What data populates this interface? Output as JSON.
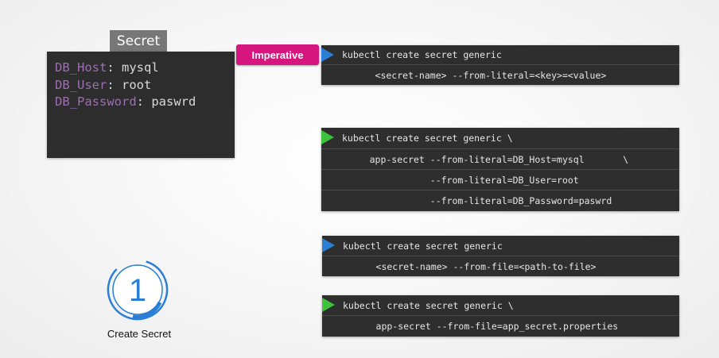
{
  "secret": {
    "tab_label": "Secret",
    "pairs": [
      {
        "key": "DB_Host",
        "value": "mysql"
      },
      {
        "key": "DB_User",
        "value": "root"
      },
      {
        "key": "DB_Password",
        "value": "paswrd"
      }
    ]
  },
  "badge": {
    "label": "Imperative",
    "color": "#d6157f"
  },
  "commands": [
    {
      "arrow_color": "blue",
      "lines": [
        "kubectl create secret generic",
        "      <secret-name> --from-literal=<key>=<value>"
      ]
    },
    {
      "arrow_color": "green",
      "lines": [
        "kubectl create secret generic \\",
        "     app-secret --from-literal=DB_Host=mysql       \\",
        "                --from-literal=DB_User=root",
        "                --from-literal=DB_Password=paswrd"
      ]
    },
    {
      "arrow_color": "blue",
      "lines": [
        "kubectl create secret generic",
        "      <secret-name> --from-file=<path-to-file>"
      ]
    },
    {
      "arrow_color": "green",
      "lines": [
        "kubectl create secret generic \\",
        "      app-secret --from-file=app_secret.properties"
      ]
    }
  ],
  "step": {
    "number": "1",
    "label": "Create Secret",
    "accent": "#2a7fd4"
  }
}
